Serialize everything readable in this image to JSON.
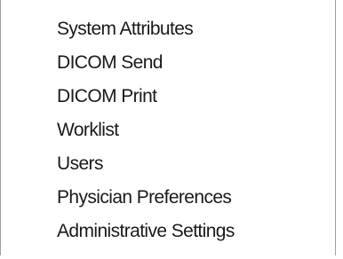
{
  "menu": {
    "items": [
      {
        "label": "System Attributes"
      },
      {
        "label": "DICOM Send"
      },
      {
        "label": "DICOM Print"
      },
      {
        "label": "Worklist"
      },
      {
        "label": "Users"
      },
      {
        "label": "Physician Preferences"
      },
      {
        "label": "Administrative Settings"
      }
    ]
  }
}
